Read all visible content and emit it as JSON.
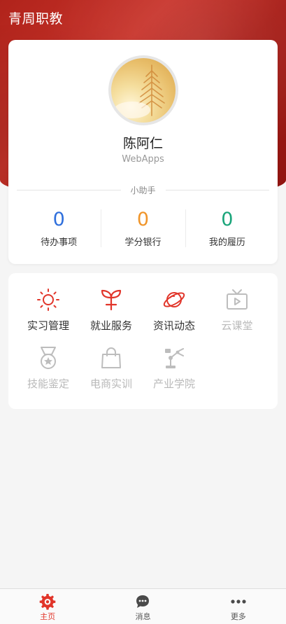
{
  "app": {
    "title": "青周职教"
  },
  "profile": {
    "name": "陈阿仁",
    "subtitle": "WebApps",
    "helper_label": "小助手"
  },
  "stats": [
    {
      "value": "0",
      "label": "待办事项",
      "color": "#2f6fdc"
    },
    {
      "value": "0",
      "label": "学分银行",
      "color": "#f0952a"
    },
    {
      "value": "0",
      "label": "我的履历",
      "color": "#1aa57a"
    }
  ],
  "menu": {
    "accent": "#e1352a",
    "disabled_color": "#bdbdbd",
    "items": [
      {
        "label": "实习管理",
        "icon": "sun-icon",
        "enabled": true
      },
      {
        "label": "就业服务",
        "icon": "sprout-icon",
        "enabled": true
      },
      {
        "label": "资讯动态",
        "icon": "planet-icon",
        "enabled": true
      },
      {
        "label": "云课堂",
        "icon": "tv-icon",
        "enabled": false
      },
      {
        "label": "技能鉴定",
        "icon": "medal-icon",
        "enabled": false
      },
      {
        "label": "电商实训",
        "icon": "shopping-bag-icon",
        "enabled": false
      },
      {
        "label": "产业学院",
        "icon": "robot-arm-icon",
        "enabled": false
      }
    ]
  },
  "tabbar": {
    "active_color": "#e1352a",
    "inactive_color": "#555555",
    "items": [
      {
        "label": "主页",
        "icon": "gear-home-icon",
        "active": true
      },
      {
        "label": "消息",
        "icon": "chat-bubble-icon",
        "active": false
      },
      {
        "label": "更多",
        "icon": "more-dots-icon",
        "active": false
      }
    ]
  }
}
